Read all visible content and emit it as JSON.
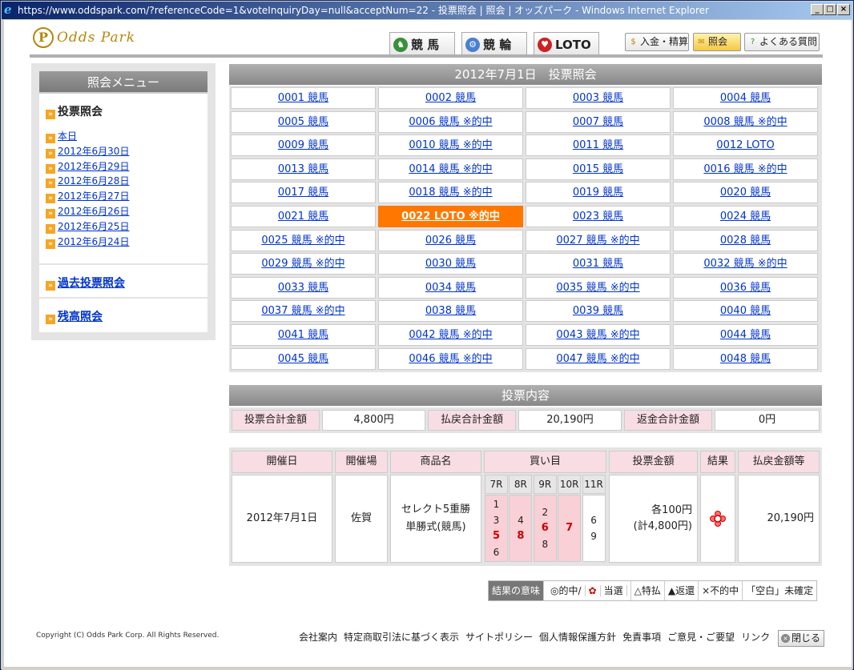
{
  "window": {
    "title": "https://www.oddspark.com/?referenceCode=1&voteInquiryDay=null&acceptNum=22 - 投票照会 | 照会 | オッズパーク - Windows Internet Explorer",
    "minimize": "_",
    "maximize": "□",
    "close": "×"
  },
  "header": {
    "logo_mark": "P",
    "logo_text": "Odds Park",
    "tabs": [
      {
        "label": "競 馬",
        "icon": "horse-icon",
        "color": "#3a8f3a"
      },
      {
        "label": "競 輪",
        "icon": "bicycle-icon",
        "color": "#4a7fd4"
      },
      {
        "label": "LOTO",
        "icon": "loto-icon",
        "color": "#cc2222"
      }
    ],
    "buttons": [
      {
        "label": "入金・精算",
        "icon": "money-bag-icon"
      },
      {
        "label": "照会",
        "icon": "ticket-icon"
      },
      {
        "label": "よくある質問",
        "icon": "question-icon"
      }
    ]
  },
  "sidebar": {
    "title": "照会メニュー",
    "section": "投票照会",
    "items": [
      "本日",
      "2012年6月30日",
      "2012年6月29日",
      "2012年6月28日",
      "2012年6月27日",
      "2012年6月26日",
      "2012年6月25日",
      "2012年6月24日"
    ],
    "past_link": "過去投票照会",
    "balance_link": "残高照会"
  },
  "main": {
    "grid_title": "2012年7月1日　投票照会",
    "selected_index": 21,
    "tickets": [
      "0001 競馬",
      "0002 競馬",
      "0003 競馬",
      "0004 競馬",
      "0005 競馬",
      "0006 競馬 ※的中",
      "0007 競馬",
      "0008 競馬 ※的中",
      "0009 競馬",
      "0010 競馬 ※的中",
      "0011 競馬",
      "0012 LOTO",
      "0013 競馬",
      "0014 競馬 ※的中",
      "0015 競馬",
      "0016 競馬 ※的中",
      "0017 競馬",
      "0018 競馬 ※的中",
      "0019 競馬",
      "0020 競馬",
      "0021 競馬",
      "0022 LOTO ※的中",
      "0023 競馬",
      "0024 競馬",
      "0025 競馬 ※的中",
      "0026 競馬",
      "0027 競馬 ※的中",
      "0028 競馬",
      "0029 競馬 ※的中",
      "0030 競馬",
      "0031 競馬",
      "0032 競馬 ※的中",
      "0033 競馬",
      "0034 競馬",
      "0035 競馬 ※的中",
      "0036 競馬",
      "0037 競馬 ※的中",
      "0038 競馬",
      "0039 競馬",
      "0040 競馬",
      "0041 競馬",
      "0042 競馬 ※的中",
      "0043 競馬 ※的中",
      "0044 競馬",
      "0045 競馬",
      "0046 競馬 ※的中",
      "0047 競馬 ※的中",
      "0048 競馬"
    ],
    "content_title": "投票内容",
    "summary": {
      "total_bet_label": "投票合計金額",
      "total_bet": "4,800円",
      "payout_label": "払戻合計金額",
      "payout": "20,190円",
      "refund_label": "返金合計金額",
      "refund": "0円"
    },
    "detail": {
      "headers": {
        "date": "開催日",
        "venue": "開催場",
        "product": "商品名",
        "picks": "買い目",
        "bet": "投票金額",
        "result": "結果",
        "payout": "払戻金額等"
      },
      "races": [
        {
          "label": "7R",
          "nums": [
            "1",
            "3",
            "5",
            "6"
          ],
          "hit": "5",
          "highlight": true
        },
        {
          "label": "8R",
          "nums": [
            "4",
            "8"
          ],
          "hit": "8",
          "highlight": true
        },
        {
          "label": "9R",
          "nums": [
            "2",
            "6",
            "8"
          ],
          "hit": "6",
          "highlight": true
        },
        {
          "label": "10R",
          "nums": [
            "7"
          ],
          "hit": "7",
          "highlight": true
        },
        {
          "label": "11R",
          "nums": [
            "6",
            "9"
          ],
          "hit": "",
          "highlight": false
        }
      ],
      "date": "2012年7月1日",
      "venue": "佐賀",
      "product_line1": "セレクト5重勝",
      "product_line2": "単勝式(競馬)",
      "bet_line1": "各100円",
      "bet_line2": "(計4,800円)",
      "result_icon": "flower-win-icon",
      "payout": "20,190円"
    },
    "legend": {
      "key": "結果の意味",
      "hit": "◎的中/",
      "win": "当選",
      "special": "△特払",
      "refund": "▲返還",
      "miss": "×不的中",
      "pending": "「空白」未確定"
    }
  },
  "footer": {
    "copyright": "Copyright (C) Odds Park Corp. All Rights Reserved.",
    "links": [
      "会社案内",
      "特定商取引法に基づく表示",
      "サイトポリシー",
      "個人情報保護方針",
      "免責事項",
      "ご意見・ご要望",
      "リンク"
    ],
    "close_label": "閉じる"
  }
}
